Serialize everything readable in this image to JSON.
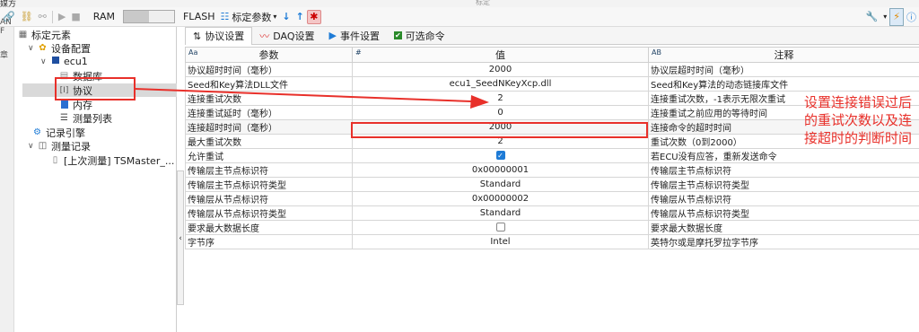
{
  "titlebar": {
    "title": "标定",
    "left_text": "媒方"
  },
  "toolbar": {
    "ram_label": "RAM",
    "flash_label": "FLASH",
    "calib_params_label": "标定参数",
    "colors": {
      "accent": "#1e7bd6",
      "bug": "#cc0000"
    }
  },
  "left_strip": {
    "t1": "章",
    "t2": "AN F"
  },
  "tree": {
    "root": "标定元素",
    "device_config": "设备配置",
    "ecu": "ecu1",
    "database": "数据库",
    "protocol": "协议",
    "memory": "内存",
    "measure_list": "测量列表",
    "record_engine": "记录引擎",
    "measure_records": "测量记录",
    "last_measure": "[上次测量] TSMaster_..."
  },
  "tabs": [
    {
      "label": "协议设置",
      "icon": "sliders-icon"
    },
    {
      "label": "DAQ设置",
      "icon": "chart-icon"
    },
    {
      "label": "事件设置",
      "icon": "play-icon"
    },
    {
      "label": "可选命令",
      "icon": "check-icon"
    }
  ],
  "grid": {
    "headers": {
      "param": "参数",
      "value": "值",
      "note": "注释",
      "param_type": "Aa",
      "value_type": "#",
      "note_type": "AB"
    },
    "rows": [
      {
        "param": "协议超时时间（毫秒）",
        "value": "2000",
        "note": "协议层超时时间（毫秒）"
      },
      {
        "param": "Seed和Key算法DLL文件",
        "value": "ecu1_SeedNKeyXcp.dll",
        "note": "Seed和Key算法的动态链接库文件"
      },
      {
        "param": "连接重试次数",
        "value": "2",
        "note": "连接重试次数，-1表示无限次重试"
      },
      {
        "param": "连接重试延时（毫秒）",
        "value": "0",
        "note": "连接重试之前应用的等待时间"
      },
      {
        "param": "连接超时时间（毫秒）",
        "value": "2000",
        "note": "连接命令的超时时间"
      },
      {
        "param": "最大重试次数",
        "value": "2",
        "note": "重试次数（0到2000）"
      },
      {
        "param": "允许重试",
        "value": "",
        "note": "若ECU没有应答，重新发送命令",
        "checkbox": true,
        "checked": true
      },
      {
        "param": "传输层主节点标识符",
        "value": "0x00000001",
        "note": "传输层主节点标识符"
      },
      {
        "param": "传输层主节点标识符类型",
        "value": "Standard",
        "note": "传输层主节点标识符类型"
      },
      {
        "param": "传输层从节点标识符",
        "value": "0x00000002",
        "note": "传输层从节点标识符"
      },
      {
        "param": "传输层从节点标识符类型",
        "value": "Standard",
        "note": "传输层从节点标识符类型"
      },
      {
        "param": "要求最大数据长度",
        "value": "",
        "note": "要求最大数据长度",
        "checkbox": true,
        "checked": false
      },
      {
        "param": "字节序",
        "value": "Intel",
        "note": "英特尔或是摩托罗拉字节序"
      }
    ]
  },
  "annotation": "设置连接错误过后的重试次数以及连接超时的判断时间",
  "annotation_color": "#e8302a"
}
